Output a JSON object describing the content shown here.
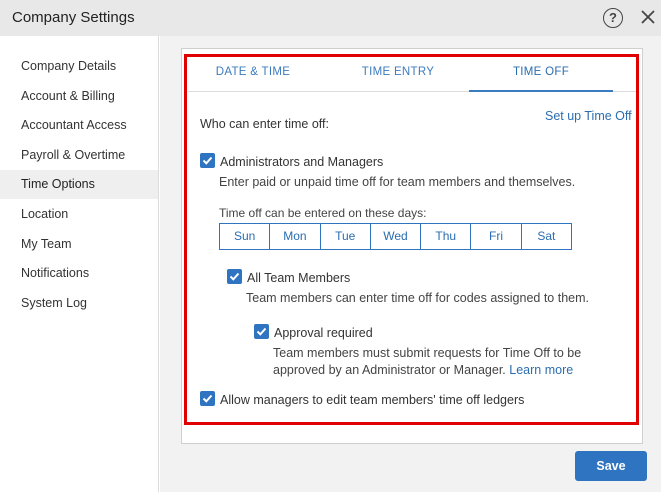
{
  "window": {
    "title": "Company Settings"
  },
  "sidebar": {
    "items": [
      {
        "label": "Company Details"
      },
      {
        "label": "Account & Billing"
      },
      {
        "label": "Accountant Access"
      },
      {
        "label": "Payroll & Overtime"
      },
      {
        "label": "Time Options",
        "active": true
      },
      {
        "label": "Location"
      },
      {
        "label": "My Team"
      },
      {
        "label": "Notifications"
      },
      {
        "label": "System Log"
      }
    ]
  },
  "tabs": [
    {
      "label": "DATE & TIME"
    },
    {
      "label": "TIME ENTRY"
    },
    {
      "label": "TIME OFF",
      "active": true
    }
  ],
  "time_off": {
    "who_label": "Who can enter time off:",
    "setup_link": "Set up Time Off",
    "admins": {
      "label": "Administrators and Managers",
      "checked": true,
      "description": "Enter paid or unpaid time off for team members and themselves."
    },
    "days_label": "Time off can be entered on these days:",
    "days": [
      "Sun",
      "Mon",
      "Tue",
      "Wed",
      "Thu",
      "Fri",
      "Sat"
    ],
    "team_members": {
      "label": "All Team Members",
      "checked": true,
      "description": "Team members can enter time off for codes assigned to them."
    },
    "approval": {
      "label": "Approval required",
      "checked": true,
      "description_line1": "Team members must submit requests for Time Off to be",
      "description_line2": "approved by an Administrator or Manager.",
      "learn_more": "Learn more"
    },
    "ledgers": {
      "label": "Allow managers to edit team members' time off ledgers",
      "checked": true
    }
  },
  "footer": {
    "save_label": "Save"
  },
  "colors": {
    "accent": "#2f74c0",
    "highlight": "#e00000"
  }
}
